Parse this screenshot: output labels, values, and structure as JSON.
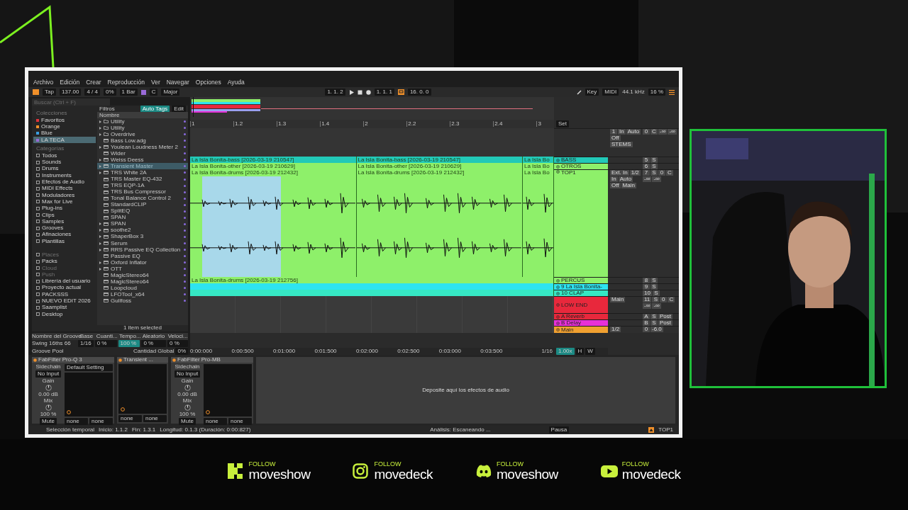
{
  "menu": [
    "Archivo",
    "Edición",
    "Crear",
    "Reproducción",
    "Ver",
    "Navegar",
    "Opciones",
    "Ayuda"
  ],
  "toolbar": {
    "tap": "Tap",
    "tempo": "137.00",
    "signature": "4 / 4",
    "swing": "0%",
    "quantize": "1 Bar",
    "root": "C",
    "scale": "Major",
    "position": "1. 1. 2",
    "loop_start": "1. 1. 1",
    "loop_length": "16. 0. 0",
    "key": "Key",
    "midi": "MIDI",
    "sample_rate": "44.1 kHz",
    "cpu": "16 %"
  },
  "browser": {
    "search": {
      "placeholder": "Buscar (Ctrl + F)"
    },
    "collections_title": "Colecciones",
    "collections": [
      {
        "label": "Favoritos",
        "color": "#e0323a",
        "selected": false
      },
      {
        "label": "Orange",
        "color": "#f0902a",
        "selected": false
      },
      {
        "label": "Blue",
        "color": "#3a9ee0",
        "selected": false
      },
      {
        "label": "LA TECA",
        "color": "#9a6ad8",
        "selected": true
      }
    ],
    "categories_title": "Categorías",
    "categories": [
      "Todos",
      "Sounds",
      "Drums",
      "Instruments",
      "Efectos de Audio",
      "MIDI Effects",
      "Moduladores",
      "Max for Live",
      "Plug-ins",
      "Clips",
      "Samples",
      "Grooves",
      "Afinaciones",
      "Plantillas"
    ],
    "places": [
      {
        "label": "Places",
        "disabled": true
      },
      {
        "label": "Packs",
        "disabled": false
      },
      {
        "label": "Cloud",
        "disabled": true
      },
      {
        "label": "Push",
        "disabled": true
      },
      {
        "label": "Librería del usuario",
        "disabled": false
      },
      {
        "label": "Proyecto actual",
        "disabled": false
      },
      {
        "label": "PACKSSS",
        "disabled": false
      },
      {
        "label": "NUEVO EDIT 2026",
        "disabled": false
      },
      {
        "label": "Saamplist",
        "disabled": false
      },
      {
        "label": "Desktop",
        "disabled": false
      }
    ],
    "filters": "Filtros",
    "auto_tags": "Auto Tags",
    "edit": "Edit",
    "column": "Nombre",
    "items": [
      {
        "label": "Utility",
        "kind": "folder",
        "expandable": true,
        "selected": false
      },
      {
        "label": "Utility",
        "kind": "folder",
        "expandable": true,
        "selected": false
      },
      {
        "label": "Overdrive",
        "kind": "folder",
        "expandable": true,
        "selected": false
      },
      {
        "label": "Bass Low.adg",
        "kind": "plugin",
        "expandable": false,
        "selected": false
      },
      {
        "label": "Youlean Loudness Meter 2",
        "kind": "plugin",
        "expandable": true,
        "selected": false
      },
      {
        "label": "Wider",
        "kind": "plugin",
        "expandable": false,
        "selected": false
      },
      {
        "label": "Weiss Deess",
        "kind": "plugin",
        "expandable": true,
        "selected": false
      },
      {
        "label": "Transient Master",
        "kind": "plugin",
        "expandable": true,
        "selected": true
      },
      {
        "label": "TRS White 2A",
        "kind": "plugin",
        "expandable": true,
        "selected": false
      },
      {
        "label": "TRS Master EQ-432",
        "kind": "plugin",
        "expandable": false,
        "selected": false
      },
      {
        "label": "TRS EQP-1A",
        "kind": "plugin",
        "expandable": false,
        "selected": false
      },
      {
        "label": "TRS Bus Compressor",
        "kind": "plugin",
        "expandable": false,
        "selected": false
      },
      {
        "label": "Tonal Balance Control 2",
        "kind": "plugin",
        "expandable": false,
        "selected": false
      },
      {
        "label": "StandardCLIP",
        "kind": "plugin",
        "expandable": false,
        "selected": false
      },
      {
        "label": "SplitEQ",
        "kind": "plugin",
        "expandable": false,
        "selected": false
      },
      {
        "label": "SPAN",
        "kind": "plugin",
        "expandable": false,
        "selected": false
      },
      {
        "label": "SPAN",
        "kind": "plugin",
        "expandable": true,
        "selected": false
      },
      {
        "label": "soothe2",
        "kind": "plugin",
        "expandable": true,
        "selected": false
      },
      {
        "label": "ShaperBox 3",
        "kind": "plugin",
        "expandable": true,
        "selected": false
      },
      {
        "label": "Serum",
        "kind": "plugin",
        "expandable": true,
        "selected": false
      },
      {
        "label": "RRS Passive EQ Collection",
        "kind": "plugin",
        "expandable": true,
        "selected": false
      },
      {
        "label": "Passive EQ",
        "kind": "plugin",
        "expandable": false,
        "selected": false
      },
      {
        "label": "Oxford Inflator",
        "kind": "plugin",
        "expandable": true,
        "selected": false
      },
      {
        "label": "OTT",
        "kind": "plugin",
        "expandable": true,
        "selected": false
      },
      {
        "label": "MagicStereo64",
        "kind": "plugin",
        "expandable": false,
        "selected": false
      },
      {
        "label": "MagicStereo64",
        "kind": "plugin",
        "expandable": false,
        "selected": false
      },
      {
        "label": "Loopcloud",
        "kind": "plugin",
        "expandable": false,
        "selected": false
      },
      {
        "label": "LFOTool_x64",
        "kind": "plugin",
        "expandable": false,
        "selected": false
      },
      {
        "label": "Gullfoss",
        "kind": "plugin",
        "expandable": false,
        "selected": false
      }
    ],
    "footer": "1 item selected"
  },
  "groove": {
    "columns": [
      "Nombre del Groove",
      "Base",
      "Cuanti...",
      "Tempo...",
      "Aleatorio",
      "Veloci..."
    ],
    "row": [
      "Swing 16ths 66",
      "1/16",
      "0 %",
      "100 %",
      "0 %",
      "0 %"
    ],
    "title": "Groove Pool",
    "amount_label": "Cantidad Global",
    "amount": "0%"
  },
  "arrangement": {
    "ruler": [
      "1",
      "1.2",
      "1.3",
      "1.4",
      "2",
      "2.2",
      "2.3",
      "2.4",
      "3"
    ],
    "set": "Set",
    "master": {
      "io": [
        "1",
        "In",
        "Auto",
        "Off",
        "STEMS"
      ],
      "controls": [
        "0",
        "C",
        "-∞",
        "-∞"
      ]
    },
    "tracks": [
      {
        "name": "BASS",
        "kind": "audio",
        "color": "#22c9b8",
        "expanded": false,
        "clips": [
          {
            "label": "La Isla Bonita-bass [2026-03-19 210547]",
            "selected": false
          },
          {
            "label": "La Isla Bonita-bass [2026-03-19 210547]",
            "selected": false
          },
          {
            "label": "La Isla Bo",
            "selected": false
          }
        ],
        "controls": [
          "5",
          "S"
        ]
      },
      {
        "name": "OTROS",
        "kind": "audio",
        "color": "#8ef06a",
        "expanded": false,
        "clips": [
          {
            "label": "La Isla Bonita-other [2026-03-19 210629]",
            "selected": false
          },
          {
            "label": "La Isla Bonita-other [2026-03-19 210629]",
            "selected": false
          },
          {
            "label": "La Isla Bo",
            "selected": false
          }
        ],
        "controls": [
          "6",
          "S"
        ]
      },
      {
        "name": "TOP1",
        "kind": "audio",
        "color": "#8ef06a",
        "expanded": true,
        "clips": [
          {
            "label": "La Isla Bonita-drums [2026-03-19 212432]",
            "selected": true
          },
          {
            "label": "La Isla Bonita-drums [2026-03-19 212432]",
            "selected": false
          },
          {
            "label": "La Isla Bo",
            "selected": false
          }
        ],
        "io": [
          "Ext. In",
          "1/2",
          "In",
          "Auto",
          "Off",
          "Main"
        ],
        "controls": [
          "7",
          "S",
          "0",
          "C",
          "-∞",
          "-∞"
        ]
      },
      {
        "name": "PERCUS",
        "kind": "audio",
        "color": "#8ef06a",
        "expanded": false,
        "clips": [
          {
            "label": "La Isla Bonita-drums [2026-03-19 212756]",
            "selected": false
          }
        ],
        "controls": [
          "8",
          "S"
        ]
      },
      {
        "name": "9 La Isla Bonita-",
        "kind": "audio",
        "color": "#2ee4f0",
        "expanded": false,
        "clips": [
          {
            "selected": false
          }
        ],
        "controls": [
          "9",
          "S"
        ]
      },
      {
        "name": "10 CLAP",
        "kind": "audio",
        "color": "#36e8c4",
        "expanded": false,
        "clips": [
          {
            "selected": false
          }
        ],
        "controls": [
          "10",
          "S"
        ]
      },
      {
        "name": "LOW END",
        "kind": "group",
        "color": "#e8283c",
        "expanded": false,
        "io": [
          "Main"
        ],
        "controls": [
          "11",
          "S",
          "0",
          "C",
          "-∞",
          "-∞"
        ]
      },
      {
        "name": "A Reverb",
        "kind": "return",
        "color": "#e8283c",
        "expanded": false,
        "controls": [
          "A",
          "S",
          "Post"
        ]
      },
      {
        "name": "B Delay",
        "kind": "return",
        "color": "#e830d8",
        "expanded": false,
        "controls": [
          "B",
          "S",
          "Post"
        ]
      },
      {
        "name": "Main",
        "kind": "main",
        "color": "#f0a030",
        "expanded": false,
        "io": [
          "1/2"
        ],
        "controls": [
          "0",
          "-6.0"
        ]
      }
    ],
    "time": [
      "0:00:000",
      "0:00:500",
      "0:01:000",
      "0:01:500",
      "0:02:000",
      "0:02:500",
      "0:03:000",
      "0:03:500"
    ],
    "grid": "1/16",
    "zoom": "1.00x",
    "h": "H",
    "w": "W"
  },
  "devices": [
    {
      "title": "FabFilter Pro-Q 3",
      "sidechain": [
        "Sidechain",
        "No Input",
        "Gain",
        "0.00 dB",
        "Mix",
        "100 %",
        "Mute"
      ],
      "preset": "Default Setting",
      "selectors": [
        "none",
        "none"
      ]
    },
    {
      "title": "Transient ...",
      "selectors": [
        "none",
        "none"
      ]
    },
    {
      "title": "FabFilter Pro-MB",
      "sidechain": [
        "Sidechain",
        "No Input",
        "Gain",
        "0.00 dB",
        "Mix",
        "100 %",
        "Mute"
      ],
      "selectors": [
        "none",
        "none"
      ]
    }
  ],
  "drop_hint": "Deposite aquí los efectos de audio",
  "status": {
    "left": [
      "Selección temporal",
      "Inicio: 1.1.2",
      "Fin: 1.3.1",
      "Longitud: 0.1.3 (Duración: 0:00:827)"
    ],
    "analysis": "Análisis: Escaneando ...",
    "pause": "Pausa",
    "track": "TOP1"
  },
  "webcam": {
    "kind": "picture"
  },
  "socials": [
    {
      "kind": "kick",
      "follow": "FOLLOW",
      "handle": "moveshow"
    },
    {
      "kind": "instagram",
      "follow": "FOLLOW",
      "handle": "movedeck"
    },
    {
      "kind": "discord",
      "follow": "FOLLOW",
      "handle": "moveshow"
    },
    {
      "kind": "youtube",
      "follow": "FOLLOW",
      "handle": "movedeck"
    }
  ]
}
